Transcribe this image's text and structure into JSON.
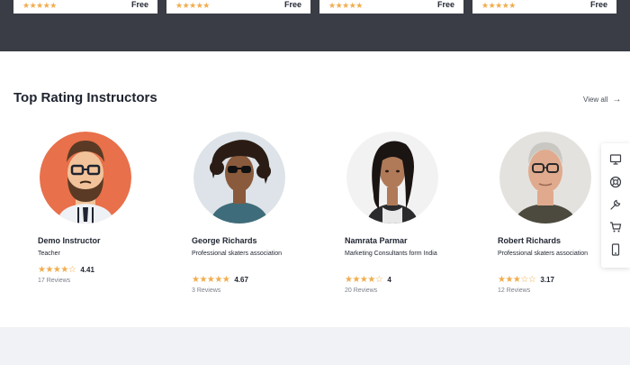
{
  "course_cards": [
    {
      "stars": "★★★★★",
      "price": "Free"
    },
    {
      "stars": "★★★★★",
      "price": "Free"
    },
    {
      "stars": "★★★★★",
      "price": "Free"
    },
    {
      "stars": "★★★★★",
      "price": "Free"
    }
  ],
  "section": {
    "title": "Top Rating Instructors",
    "view_all": "View all",
    "view_all_icon": "arrow-right-icon"
  },
  "instructors": [
    {
      "name": "Demo Instructor",
      "role": "Teacher",
      "stars": "★★★★☆",
      "rating": "4.41",
      "reviews": "17 Reviews"
    },
    {
      "name": "George Richards",
      "role": "Professional skaters association",
      "stars": "★★★★★",
      "rating": "4.67",
      "reviews": "3 Reviews"
    },
    {
      "name": "Namrata Parmar",
      "role": "Marketing Consultants form India",
      "stars": "★★★★☆",
      "rating": "4",
      "reviews": "20 Reviews"
    },
    {
      "name": "Robert Richards",
      "role": "Professional skaters association",
      "stars": "★★★☆☆",
      "rating": "3.17",
      "reviews": "12 Reviews"
    }
  ],
  "toolbar": {
    "icons": [
      "monitor-icon",
      "lifebuoy-icon",
      "wrench-icon",
      "cart-icon",
      "mobile-icon"
    ]
  },
  "colors": {
    "dark_band": "#3a3d45",
    "star": "#f0ad4e",
    "bottom_band": "#f1f2f5"
  }
}
